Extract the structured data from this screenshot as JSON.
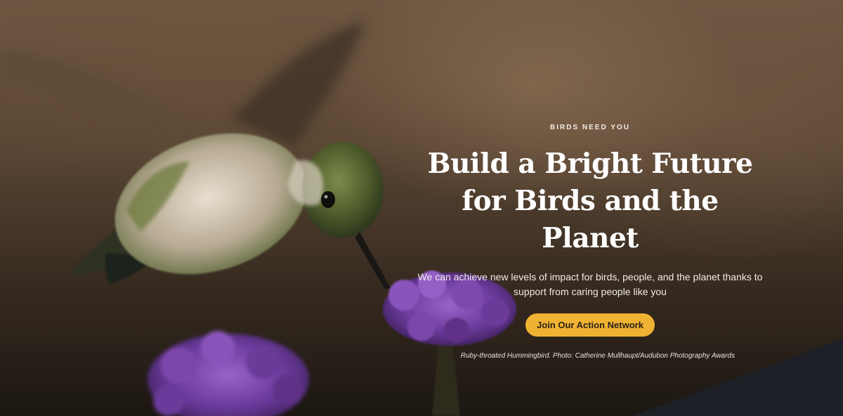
{
  "hero": {
    "eyebrow": "BIRDS NEED YOU",
    "title": "Build a Bright Future for Birds and the Planet",
    "description": "We can achieve new levels of impact for birds, people, and the planet thanks to support from caring people like you",
    "cta_label": "Join Our Action Network",
    "photo_caption": "Ruby-throated Hummingbird. Photo: Catherine Mullhaupt/Audubon Photography Awards"
  },
  "colors": {
    "cta_background": "#f0b232",
    "cta_text": "#2a2118",
    "text_primary": "#ffffff",
    "flower_purple": "#6a3a9a",
    "corner_shape": "#1d2026"
  }
}
